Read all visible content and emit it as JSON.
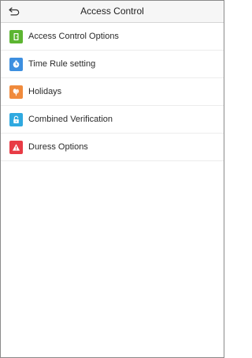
{
  "header": {
    "title": "Access Control",
    "back_icon": "back-arrow-icon"
  },
  "menu": {
    "items": [
      {
        "label": "Access Control Options",
        "icon": "door-icon",
        "color": "#5cb531"
      },
      {
        "label": "Time Rule setting",
        "icon": "clock-icon",
        "color": "#3d8fe0"
      },
      {
        "label": "Holidays",
        "icon": "holiday-icon",
        "color": "#f08a3c"
      },
      {
        "label": "Combined Verification",
        "icon": "unlock-icon",
        "color": "#2fa9e0"
      },
      {
        "label": "Duress Options",
        "icon": "warning-icon",
        "color": "#e83b45"
      }
    ]
  }
}
